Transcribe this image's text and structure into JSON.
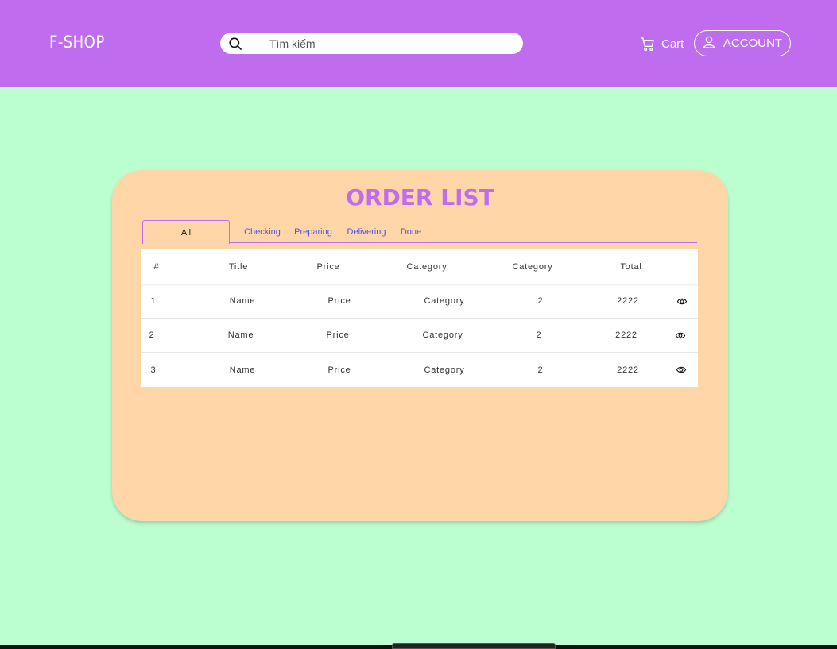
{
  "header": {
    "logo": "F-SHOP",
    "search": {
      "placeholder": "Tìm kiếm",
      "value": ""
    },
    "cart_label": "Cart",
    "account_label": "ACCOUNT"
  },
  "order_list": {
    "title": "ORDER LIST",
    "tabs": [
      {
        "label": "All",
        "active": true
      },
      {
        "label": "Checking",
        "active": false
      },
      {
        "label": "Preparing",
        "active": false
      },
      {
        "label": "Delivering",
        "active": false
      },
      {
        "label": "Done",
        "active": false
      }
    ],
    "columns": [
      "#",
      "Title",
      "Price",
      "Category",
      "Category",
      "Total"
    ],
    "rows": [
      {
        "index": "1",
        "title": "Name",
        "price": "Price",
        "category": "Category",
        "quantity": "2",
        "total": "2222"
      },
      {
        "index": "2",
        "title": "Name",
        "price": "Price",
        "category": "Category",
        "quantity": "2",
        "total": "2222"
      },
      {
        "index": "3",
        "title": "Name",
        "price": "Price",
        "category": "Category",
        "quantity": "2",
        "total": "2222"
      }
    ]
  },
  "colors": {
    "header": "#bf6cee",
    "page_background": "#bbffd0",
    "card": "#fed6a8",
    "title": "#bf6cee",
    "tab_link": "#4f55e8"
  },
  "icons": [
    "search-icon",
    "cart-icon",
    "user-icon",
    "eye-icon"
  ]
}
